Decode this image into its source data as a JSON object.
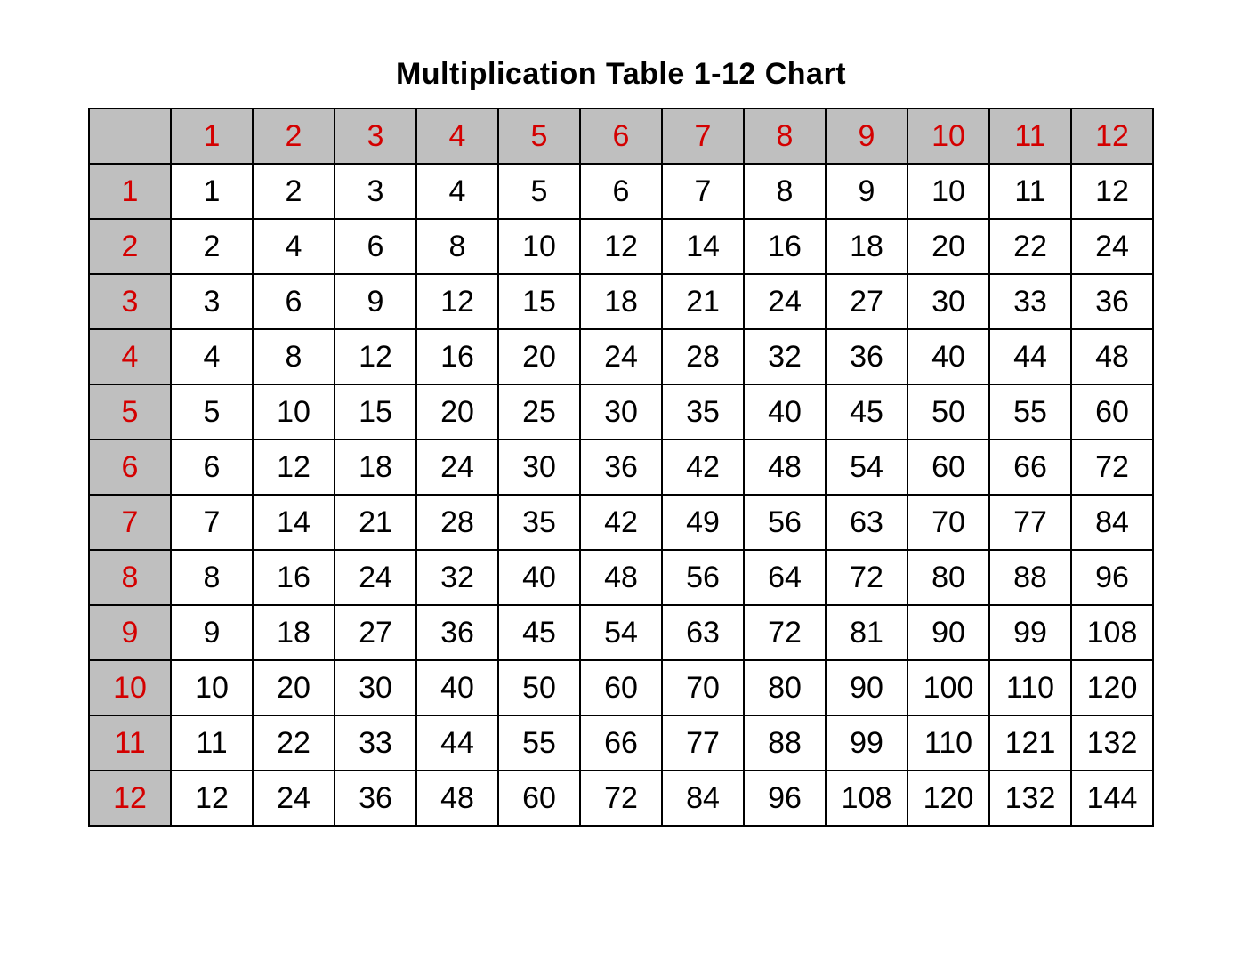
{
  "title": "Multiplication Table 1-12 Chart",
  "chart_data": {
    "type": "table",
    "title": "Multiplication Table 1-12 Chart",
    "col_headers": [
      1,
      2,
      3,
      4,
      5,
      6,
      7,
      8,
      9,
      10,
      11,
      12
    ],
    "row_headers": [
      1,
      2,
      3,
      4,
      5,
      6,
      7,
      8,
      9,
      10,
      11,
      12
    ],
    "values": [
      [
        1,
        2,
        3,
        4,
        5,
        6,
        7,
        8,
        9,
        10,
        11,
        12
      ],
      [
        2,
        4,
        6,
        8,
        10,
        12,
        14,
        16,
        18,
        20,
        22,
        24
      ],
      [
        3,
        6,
        9,
        12,
        15,
        18,
        21,
        24,
        27,
        30,
        33,
        36
      ],
      [
        4,
        8,
        12,
        16,
        20,
        24,
        28,
        32,
        36,
        40,
        44,
        48
      ],
      [
        5,
        10,
        15,
        20,
        25,
        30,
        35,
        40,
        45,
        50,
        55,
        60
      ],
      [
        6,
        12,
        18,
        24,
        30,
        36,
        42,
        48,
        54,
        60,
        66,
        72
      ],
      [
        7,
        14,
        21,
        28,
        35,
        42,
        49,
        56,
        63,
        70,
        77,
        84
      ],
      [
        8,
        16,
        24,
        32,
        40,
        48,
        56,
        64,
        72,
        80,
        88,
        96
      ],
      [
        9,
        18,
        27,
        36,
        45,
        54,
        63,
        72,
        81,
        90,
        99,
        108
      ],
      [
        10,
        20,
        30,
        40,
        50,
        60,
        70,
        80,
        90,
        100,
        110,
        120
      ],
      [
        11,
        22,
        33,
        44,
        55,
        66,
        77,
        88,
        99,
        110,
        121,
        132
      ],
      [
        12,
        24,
        36,
        48,
        60,
        72,
        84,
        96,
        108,
        120,
        132,
        144
      ]
    ]
  },
  "colors": {
    "header_bg": "#bfbfbf",
    "header_text": "#d40000",
    "cell_text": "#000000",
    "cell_bg": "#ffffff",
    "border": "#000000"
  }
}
